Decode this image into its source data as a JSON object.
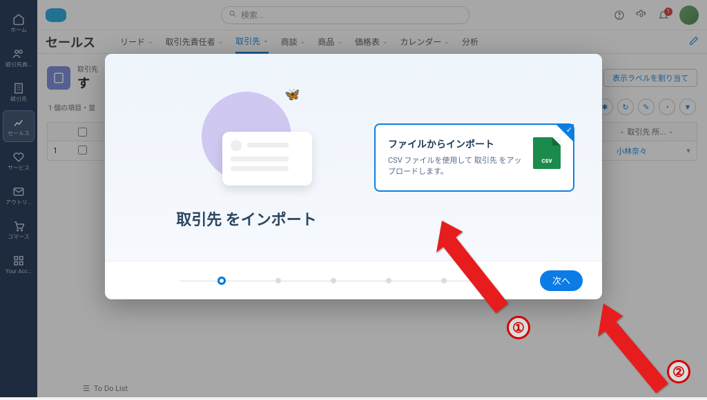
{
  "header": {
    "search_placeholder": "検索...",
    "bell_count": "1"
  },
  "rail": [
    {
      "label": "ホーム"
    },
    {
      "label": "取引先責..."
    },
    {
      "label": "取引先"
    },
    {
      "label": "セールス"
    },
    {
      "label": "サービス"
    },
    {
      "label": "アウトリ..."
    },
    {
      "label": "コマース"
    },
    {
      "label": "Your Acc..."
    }
  ],
  "nav": {
    "app": "セールス",
    "tabs": [
      "リード",
      "取引先責任者",
      "取引先",
      "商談",
      "商品",
      "価格表",
      "カレンダー",
      "分析"
    ],
    "active_index": 2
  },
  "page": {
    "breadcrumb": "取引先",
    "title_prefix": "す",
    "meta": "1 個の項目・並",
    "assign_btn": "表示ラベルを割り当て",
    "col_header": "取引先 所...",
    "row_num": "1",
    "row_name": "小林奈々"
  },
  "modal": {
    "title": "取引先 をインポート",
    "option_title": "ファイルからインポート",
    "option_desc": "CSV ファイルを使用して 取引先 をアップロードします。",
    "next": "次へ",
    "steps_total": 5,
    "steps_active": 0
  },
  "callouts": {
    "n1": "①",
    "n2": "②"
  },
  "footer": {
    "todo": "To Do List"
  }
}
